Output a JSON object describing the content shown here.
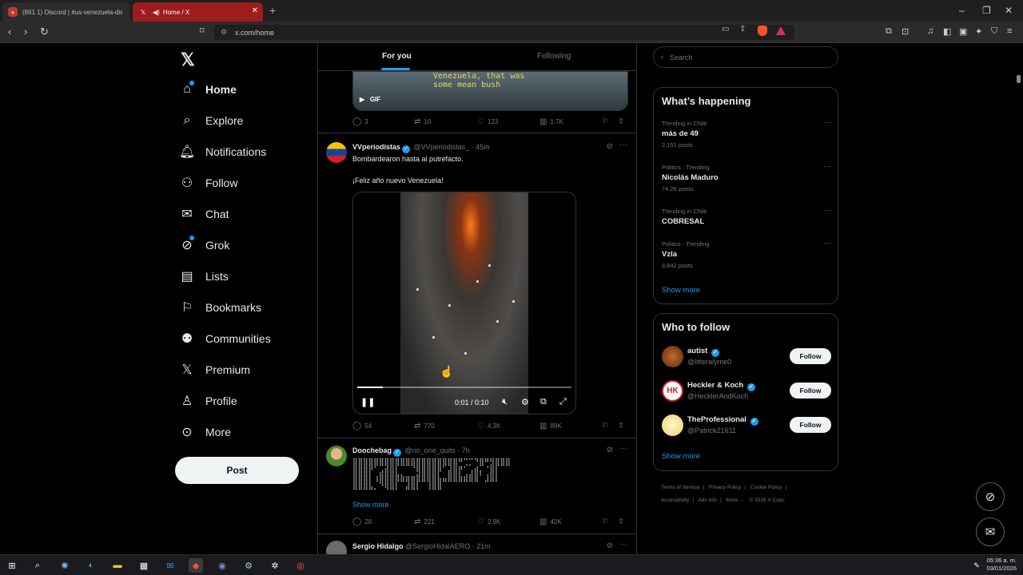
{
  "browser": {
    "tabs": [
      {
        "title": "(861 1) Discord | #us-venezuela-discu",
        "active": false
      },
      {
        "title": "Home / X",
        "active": true
      }
    ],
    "url": "x.com/home"
  },
  "sidebar": {
    "items": [
      {
        "label": "Home",
        "icon": "home-icon",
        "active": true
      },
      {
        "label": "Explore",
        "icon": "search-icon"
      },
      {
        "label": "Notifications",
        "icon": "bell-icon"
      },
      {
        "label": "Follow",
        "icon": "follow-icon"
      },
      {
        "label": "Chat",
        "icon": "mail-icon"
      },
      {
        "label": "Grok",
        "icon": "grok-icon"
      },
      {
        "label": "Lists",
        "icon": "lists-icon"
      },
      {
        "label": "Bookmarks",
        "icon": "bookmark-icon"
      },
      {
        "label": "Communities",
        "icon": "communities-icon"
      },
      {
        "label": "Premium",
        "icon": "x-icon"
      },
      {
        "label": "Profile",
        "icon": "profile-icon"
      },
      {
        "label": "More",
        "icon": "more-icon"
      }
    ],
    "post_label": "Post"
  },
  "timeline": {
    "tabs": {
      "for_you": "For you",
      "following": "Following"
    },
    "top_media": {
      "caption_line1": "Venezuela, that was",
      "caption_line2": "some mean bush",
      "badge": "GIF"
    },
    "top_actions": {
      "replies": "3",
      "reposts": "10",
      "likes": "123",
      "views": "1.7K"
    },
    "tweets": [
      {
        "name": "VVperiodistas",
        "handle": "@VVperiodistas_",
        "time": "· 45m",
        "text1": "Bombardearon hasta al putrefacto.",
        "text2": "¡Feliz año nuevo Venezuela!",
        "video_time": "0:01 / 0:10",
        "video_progress": 0.12,
        "actions": {
          "replies": "54",
          "reposts": "770",
          "likes": "4.3K",
          "views": "89K"
        }
      },
      {
        "name": "Doochebag",
        "handle": "@no_one_quits",
        "time": "· 7h",
        "art_line1": "⣿⣿⣿⣿⣿⣿⣿⣿⣿⣿⣿⣿⣿⣿⣿⣿⣿⣿⣿⣿⠛⢉⡉⠙⣿⠛⣻⣿⣿⣿",
        "art_line2": "⣿⣿⣿⡟⠁⣠⣾⣿⡇⠀⠀⠈⢿⣿⣿⣿⡿⠁⣼⣿⡟⠁⢠⣾⡄⠈⣿⡇",
        "art_line3": "⣿⣿⣿⡇⢰⣿⣿⣿⣿⣷⣶⣶⣿⣿⣿⣿⣧⣤⣿⣿⣷⣾⣿⣿⠁⣸⣿⡇",
        "art_line4": "⣿⣿⣿⣧⡀⠙⢿⣿⡇⠀⣼⣿⡇⠀⢸⣿⣿",
        "show_more": "Show more",
        "actions": {
          "replies": "28",
          "reposts": "221",
          "likes": "2.9K",
          "views": "42K"
        }
      },
      {
        "name": "Sergio Hidalgo",
        "handle": "@SergioHidalAERO",
        "time": "· 21m"
      }
    ]
  },
  "right": {
    "search_placeholder": "Search",
    "happening_title": "What’s happening",
    "trends": [
      {
        "meta": "Trending in Chile",
        "name": "más de 49",
        "count": "2,151 posts"
      },
      {
        "meta": "Politics · Trending",
        "name": "Nicolás Maduro",
        "count": "74.2K posts"
      },
      {
        "meta": "Trending in Chile",
        "name": "COBRESAL",
        "count": ""
      },
      {
        "meta": "Politics · Trending",
        "name": "Vzla",
        "count": "8,842 posts"
      }
    ],
    "show_more": "Show more",
    "who_title": "Who to follow",
    "who": [
      {
        "name": "autist",
        "handle": "@litteralyme0",
        "button": "Follow"
      },
      {
        "name": "Heckler & Koch",
        "handle": "@HecklerAndKoch",
        "button": "Follow"
      },
      {
        "name": "TheProfessional",
        "handle": "@Patrick21611",
        "button": "Follow"
      }
    ],
    "who_show_more": "Show more",
    "footer": {
      "terms": "Terms of Service",
      "privacy": "Privacy Policy",
      "cookie": "Cookie Policy",
      "accessibility": "Accessibility",
      "ads": "Ads info",
      "more": "More ···",
      "copyright": "© 2026 X Corp."
    }
  },
  "taskbar": {
    "time": "05:36 a. m.",
    "date": "03/01/2026"
  },
  "colors": {
    "accent": "#1d9bf0",
    "background": "#000000",
    "border": "#2f3336",
    "muted": "#71767b"
  }
}
